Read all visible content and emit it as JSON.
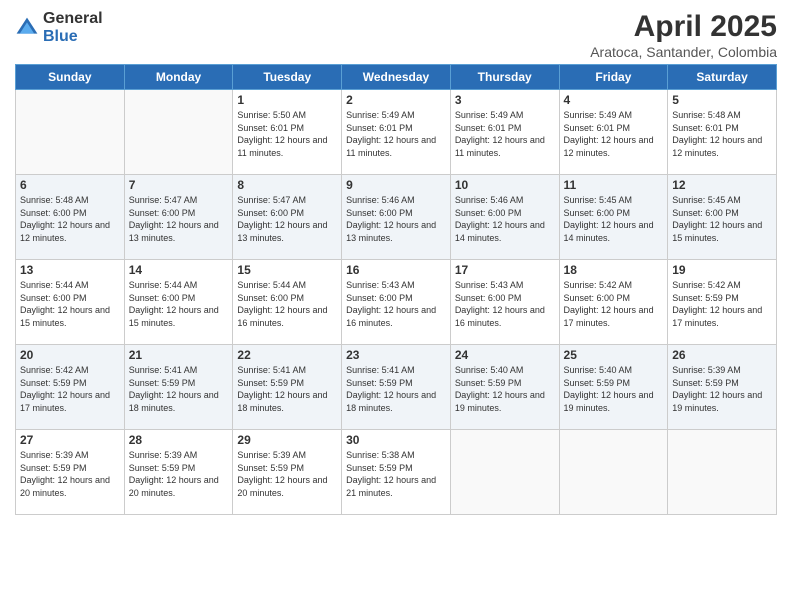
{
  "logo": {
    "general": "General",
    "blue": "Blue"
  },
  "header": {
    "month": "April 2025",
    "location": "Aratoca, Santander, Colombia"
  },
  "weekdays": [
    "Sunday",
    "Monday",
    "Tuesday",
    "Wednesday",
    "Thursday",
    "Friday",
    "Saturday"
  ],
  "weeks": [
    [
      {
        "day": "",
        "sunrise": "",
        "sunset": "",
        "daylight": ""
      },
      {
        "day": "",
        "sunrise": "",
        "sunset": "",
        "daylight": ""
      },
      {
        "day": "1",
        "sunrise": "Sunrise: 5:50 AM",
        "sunset": "Sunset: 6:01 PM",
        "daylight": "Daylight: 12 hours and 11 minutes."
      },
      {
        "day": "2",
        "sunrise": "Sunrise: 5:49 AM",
        "sunset": "Sunset: 6:01 PM",
        "daylight": "Daylight: 12 hours and 11 minutes."
      },
      {
        "day": "3",
        "sunrise": "Sunrise: 5:49 AM",
        "sunset": "Sunset: 6:01 PM",
        "daylight": "Daylight: 12 hours and 11 minutes."
      },
      {
        "day": "4",
        "sunrise": "Sunrise: 5:49 AM",
        "sunset": "Sunset: 6:01 PM",
        "daylight": "Daylight: 12 hours and 12 minutes."
      },
      {
        "day": "5",
        "sunrise": "Sunrise: 5:48 AM",
        "sunset": "Sunset: 6:01 PM",
        "daylight": "Daylight: 12 hours and 12 minutes."
      }
    ],
    [
      {
        "day": "6",
        "sunrise": "Sunrise: 5:48 AM",
        "sunset": "Sunset: 6:00 PM",
        "daylight": "Daylight: 12 hours and 12 minutes."
      },
      {
        "day": "7",
        "sunrise": "Sunrise: 5:47 AM",
        "sunset": "Sunset: 6:00 PM",
        "daylight": "Daylight: 12 hours and 13 minutes."
      },
      {
        "day": "8",
        "sunrise": "Sunrise: 5:47 AM",
        "sunset": "Sunset: 6:00 PM",
        "daylight": "Daylight: 12 hours and 13 minutes."
      },
      {
        "day": "9",
        "sunrise": "Sunrise: 5:46 AM",
        "sunset": "Sunset: 6:00 PM",
        "daylight": "Daylight: 12 hours and 13 minutes."
      },
      {
        "day": "10",
        "sunrise": "Sunrise: 5:46 AM",
        "sunset": "Sunset: 6:00 PM",
        "daylight": "Daylight: 12 hours and 14 minutes."
      },
      {
        "day": "11",
        "sunrise": "Sunrise: 5:45 AM",
        "sunset": "Sunset: 6:00 PM",
        "daylight": "Daylight: 12 hours and 14 minutes."
      },
      {
        "day": "12",
        "sunrise": "Sunrise: 5:45 AM",
        "sunset": "Sunset: 6:00 PM",
        "daylight": "Daylight: 12 hours and 15 minutes."
      }
    ],
    [
      {
        "day": "13",
        "sunrise": "Sunrise: 5:44 AM",
        "sunset": "Sunset: 6:00 PM",
        "daylight": "Daylight: 12 hours and 15 minutes."
      },
      {
        "day": "14",
        "sunrise": "Sunrise: 5:44 AM",
        "sunset": "Sunset: 6:00 PM",
        "daylight": "Daylight: 12 hours and 15 minutes."
      },
      {
        "day": "15",
        "sunrise": "Sunrise: 5:44 AM",
        "sunset": "Sunset: 6:00 PM",
        "daylight": "Daylight: 12 hours and 16 minutes."
      },
      {
        "day": "16",
        "sunrise": "Sunrise: 5:43 AM",
        "sunset": "Sunset: 6:00 PM",
        "daylight": "Daylight: 12 hours and 16 minutes."
      },
      {
        "day": "17",
        "sunrise": "Sunrise: 5:43 AM",
        "sunset": "Sunset: 6:00 PM",
        "daylight": "Daylight: 12 hours and 16 minutes."
      },
      {
        "day": "18",
        "sunrise": "Sunrise: 5:42 AM",
        "sunset": "Sunset: 6:00 PM",
        "daylight": "Daylight: 12 hours and 17 minutes."
      },
      {
        "day": "19",
        "sunrise": "Sunrise: 5:42 AM",
        "sunset": "Sunset: 5:59 PM",
        "daylight": "Daylight: 12 hours and 17 minutes."
      }
    ],
    [
      {
        "day": "20",
        "sunrise": "Sunrise: 5:42 AM",
        "sunset": "Sunset: 5:59 PM",
        "daylight": "Daylight: 12 hours and 17 minutes."
      },
      {
        "day": "21",
        "sunrise": "Sunrise: 5:41 AM",
        "sunset": "Sunset: 5:59 PM",
        "daylight": "Daylight: 12 hours and 18 minutes."
      },
      {
        "day": "22",
        "sunrise": "Sunrise: 5:41 AM",
        "sunset": "Sunset: 5:59 PM",
        "daylight": "Daylight: 12 hours and 18 minutes."
      },
      {
        "day": "23",
        "sunrise": "Sunrise: 5:41 AM",
        "sunset": "Sunset: 5:59 PM",
        "daylight": "Daylight: 12 hours and 18 minutes."
      },
      {
        "day": "24",
        "sunrise": "Sunrise: 5:40 AM",
        "sunset": "Sunset: 5:59 PM",
        "daylight": "Daylight: 12 hours and 19 minutes."
      },
      {
        "day": "25",
        "sunrise": "Sunrise: 5:40 AM",
        "sunset": "Sunset: 5:59 PM",
        "daylight": "Daylight: 12 hours and 19 minutes."
      },
      {
        "day": "26",
        "sunrise": "Sunrise: 5:39 AM",
        "sunset": "Sunset: 5:59 PM",
        "daylight": "Daylight: 12 hours and 19 minutes."
      }
    ],
    [
      {
        "day": "27",
        "sunrise": "Sunrise: 5:39 AM",
        "sunset": "Sunset: 5:59 PM",
        "daylight": "Daylight: 12 hours and 20 minutes."
      },
      {
        "day": "28",
        "sunrise": "Sunrise: 5:39 AM",
        "sunset": "Sunset: 5:59 PM",
        "daylight": "Daylight: 12 hours and 20 minutes."
      },
      {
        "day": "29",
        "sunrise": "Sunrise: 5:39 AM",
        "sunset": "Sunset: 5:59 PM",
        "daylight": "Daylight: 12 hours and 20 minutes."
      },
      {
        "day": "30",
        "sunrise": "Sunrise: 5:38 AM",
        "sunset": "Sunset: 5:59 PM",
        "daylight": "Daylight: 12 hours and 21 minutes."
      },
      {
        "day": "",
        "sunrise": "",
        "sunset": "",
        "daylight": ""
      },
      {
        "day": "",
        "sunrise": "",
        "sunset": "",
        "daylight": ""
      },
      {
        "day": "",
        "sunrise": "",
        "sunset": "",
        "daylight": ""
      }
    ]
  ]
}
